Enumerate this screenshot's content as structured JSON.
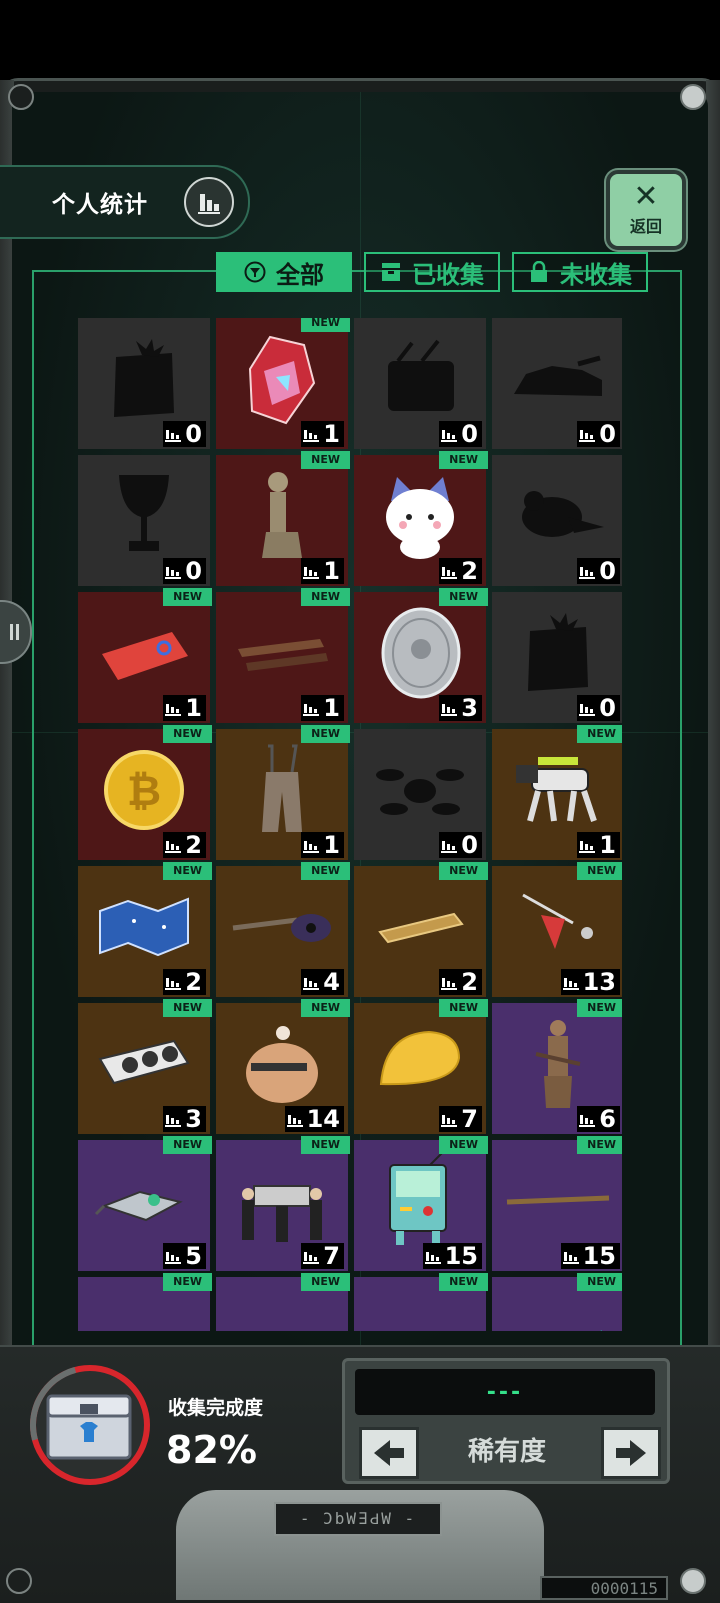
{
  "header": {
    "stats_label": "个人统计",
    "back_label": "返回"
  },
  "tabs": [
    {
      "label": "全部",
      "active": true,
      "icon": "filter-icon"
    },
    {
      "label": "已收集",
      "active": false,
      "icon": "box-icon"
    },
    {
      "label": "未收集",
      "active": false,
      "icon": "lock-icon"
    }
  ],
  "new_badge": "NEW",
  "items": [
    {
      "name": "silhouette-crate-plant",
      "count": "0",
      "rarity": "gray",
      "is_new": false,
      "icon": "crate-silhouette"
    },
    {
      "name": "rainbow-crystal",
      "count": "1",
      "rarity": "red",
      "is_new": true,
      "icon": "crystal"
    },
    {
      "name": "silhouette-radio",
      "count": "0",
      "rarity": "gray",
      "is_new": false,
      "icon": "radio-silhouette"
    },
    {
      "name": "silhouette-car",
      "count": "0",
      "rarity": "gray",
      "is_new": false,
      "icon": "car-silhouette"
    },
    {
      "name": "silhouette-goblet",
      "count": "0",
      "rarity": "gray",
      "is_new": false,
      "icon": "goblet-silhouette"
    },
    {
      "name": "stone-statue",
      "count": "1",
      "rarity": "red",
      "is_new": true,
      "icon": "statue"
    },
    {
      "name": "cat-plush",
      "count": "2",
      "rarity": "red",
      "is_new": true,
      "icon": "cat"
    },
    {
      "name": "silhouette-creature",
      "count": "0",
      "rarity": "gray",
      "is_new": false,
      "icon": "creature-silhouette"
    },
    {
      "name": "metro-card",
      "count": "1",
      "rarity": "red",
      "is_new": true,
      "icon": "card"
    },
    {
      "name": "wooden-sticks",
      "count": "1",
      "rarity": "red",
      "is_new": true,
      "icon": "sticks"
    },
    {
      "name": "silver-coin",
      "count": "3",
      "rarity": "red",
      "is_new": true,
      "icon": "silver-coin"
    },
    {
      "name": "silhouette-crate-plant-2",
      "count": "0",
      "rarity": "gray",
      "is_new": false,
      "icon": "crate-silhouette"
    },
    {
      "name": "bitcoin",
      "count": "2",
      "rarity": "red",
      "is_new": true,
      "icon": "gold-coin"
    },
    {
      "name": "overalls",
      "count": "1",
      "rarity": "orange",
      "is_new": true,
      "icon": "overalls"
    },
    {
      "name": "silhouette-drone",
      "count": "0",
      "rarity": "gray",
      "is_new": false,
      "icon": "drone-silhouette"
    },
    {
      "name": "robot-dog",
      "count": "1",
      "rarity": "orange",
      "is_new": true,
      "icon": "robot-dog"
    },
    {
      "name": "star-map",
      "count": "2",
      "rarity": "orange",
      "is_new": true,
      "icon": "map"
    },
    {
      "name": "guitar",
      "count": "4",
      "rarity": "orange",
      "is_new": true,
      "icon": "guitar"
    },
    {
      "name": "gold-phone",
      "count": "2",
      "rarity": "orange",
      "is_new": true,
      "icon": "phone"
    },
    {
      "name": "spinning-top",
      "count": "13",
      "rarity": "orange",
      "is_new": true,
      "icon": "top"
    },
    {
      "name": "graphics-card",
      "count": "3",
      "rarity": "orange",
      "is_new": true,
      "icon": "gpu"
    },
    {
      "name": "chick-toy",
      "count": "14",
      "rarity": "orange",
      "is_new": true,
      "icon": "chick"
    },
    {
      "name": "cheese",
      "count": "7",
      "rarity": "orange",
      "is_new": true,
      "icon": "cheese"
    },
    {
      "name": "terracotta-warrior",
      "count": "6",
      "rarity": "purple",
      "is_new": true,
      "icon": "warrior"
    },
    {
      "name": "gadget",
      "count": "5",
      "rarity": "purple",
      "is_new": true,
      "icon": "gadget"
    },
    {
      "name": "pallbearers",
      "count": "7",
      "rarity": "purple",
      "is_new": true,
      "icon": "pallbearers"
    },
    {
      "name": "bmo-robot",
      "count": "15",
      "rarity": "purple",
      "is_new": true,
      "icon": "bmo"
    },
    {
      "name": "wand",
      "count": "15",
      "rarity": "purple",
      "is_new": true,
      "icon": "wand"
    },
    {
      "name": "item-29",
      "count": "",
      "rarity": "purple",
      "is_new": true,
      "icon": "unknown"
    },
    {
      "name": "item-30",
      "count": "",
      "rarity": "purple",
      "is_new": true,
      "icon": "unknown"
    },
    {
      "name": "item-31",
      "count": "",
      "rarity": "purple",
      "is_new": true,
      "icon": "unknown"
    },
    {
      "name": "item-32",
      "count": "",
      "rarity": "purple",
      "is_new": true,
      "icon": "card-teal"
    }
  ],
  "footer": {
    "complete_label": "收集完成度",
    "complete_value": "82%",
    "complete_fraction": 0.82,
    "rarity_display": "---",
    "rarity_label": "稀有度",
    "plate_text": "- ƆbW∃ԀW -",
    "counter_text": "0000115"
  },
  "colors": {
    "accent_green": "#2bbf79",
    "rarity_gray": "#2e2e2e",
    "rarity_red": "#4e1717",
    "rarity_orange": "#4d3312",
    "rarity_purple": "#4a2f6c",
    "progress_red": "#d8262c"
  }
}
